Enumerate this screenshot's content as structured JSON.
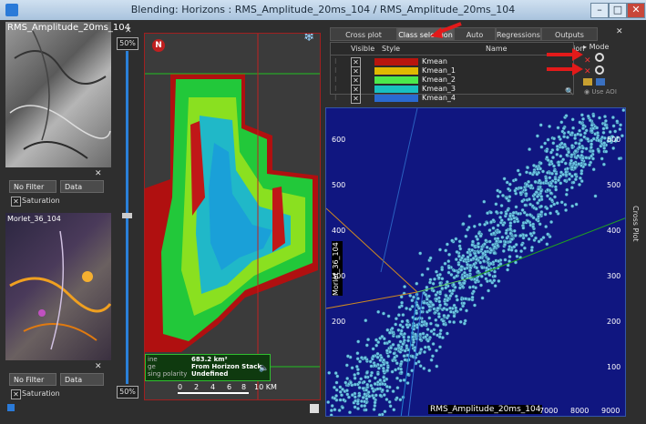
{
  "window": {
    "title": "Blending: Horizons : RMS_Amplitude_20ms_104 / RMS_Amplitude_20ms_104",
    "minimize": "–",
    "maximize": "□",
    "close": "✕"
  },
  "left_panels": [
    {
      "label": "RMS_Amplitude_20ms_104",
      "filter": "No Filter",
      "data": "Data",
      "saturation": "Saturation"
    },
    {
      "label": "Morlet_36_104",
      "filter": "No Filter",
      "data": "Data",
      "saturation": "Saturation"
    }
  ],
  "slider": {
    "top_value": "50%",
    "bottom_value": "50%",
    "close": "✕"
  },
  "map": {
    "north": "N",
    "info": {
      "left_lines": [
        "ine",
        "ge",
        "sing polarity"
      ],
      "area": "683.2 km²",
      "source": "From Horizon Stack",
      "status": "Undefined"
    },
    "scale_labels": [
      "0",
      "2",
      "4",
      "6",
      "8",
      "10 KM"
    ]
  },
  "tabs": [
    "Cross plot creation",
    "Class selection",
    "Auto classif",
    "Regressions",
    "Outputs creation"
  ],
  "class_table": {
    "headers": {
      "visible": "Visible",
      "style": "Style",
      "name": "Name"
    },
    "rows": [
      {
        "name": "Kmean",
        "color": "#b8150e"
      },
      {
        "name": "Kmean_1",
        "color": "#e0b800"
      },
      {
        "name": "Kmean_2",
        "color": "#4ce84c"
      },
      {
        "name": "Kmean_3",
        "color": "#18c0c0"
      },
      {
        "name": "Kmean_4",
        "color": "#2a6ad0"
      }
    ],
    "mode_label": "Mode",
    "use_aoi": "Use AOI"
  },
  "crossplot": {
    "side_label": "Cross Plot",
    "x_axis_label": "RMS_Amplitude_20ms_104",
    "y_axis_label": "Morlet_36_104",
    "y_ticks_left": [
      "600",
      "500",
      "400",
      "300",
      "200"
    ],
    "y_ticks_right": [
      "600",
      "500",
      "400",
      "300",
      "200",
      "100"
    ],
    "x_ticks": [
      "7000",
      "8000",
      "9000"
    ]
  }
}
